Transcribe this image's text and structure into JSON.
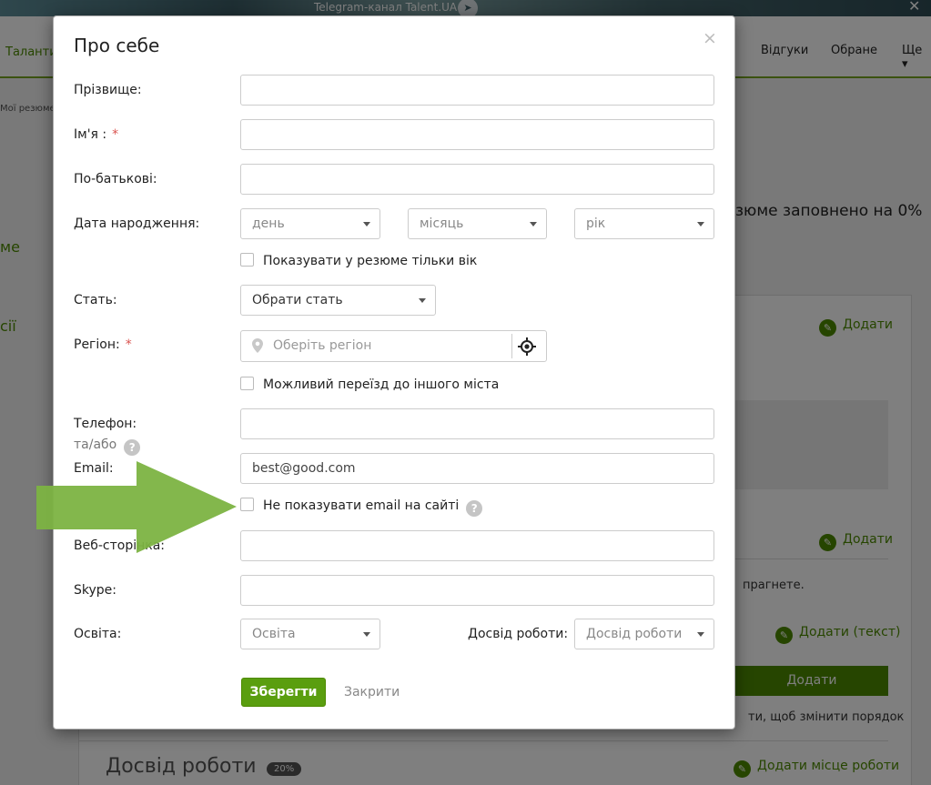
{
  "background": {
    "telegram_text": "Telegram-канал Talent.UA",
    "nav_left": "Таланти",
    "nav_items": [
      "Відгуки",
      "Обране",
      "Ще ▾"
    ],
    "breadcrumb": "Мої резюме",
    "side_items": [
      "ме",
      "сії"
    ],
    "filled_text": "зюме заповнено на 0%",
    "add_label": "Додати",
    "aspirations_text": "прагнете.",
    "add_text_label": "Додати (текст)",
    "add_button": "Додати",
    "order_text": "ти, щоб змінити порядок",
    "experience_title": "Досвід роботи",
    "experience_badge": "20%",
    "add_place_label": "Додати місце роботи"
  },
  "modal": {
    "title": "Про себе",
    "close": "×",
    "surname_label": "Прізвище:",
    "name_label": "Ім'я :",
    "patronymic_label": "По-батькові:",
    "birth_label": "Дата народження:",
    "day_placeholder": "день",
    "month_placeholder": "місяць",
    "year_placeholder": "рік",
    "age_only_checkbox": "Показувати у резюме тільки вік",
    "gender_label": "Стать:",
    "gender_placeholder": "Обрати стать",
    "region_label": "Регіон:",
    "region_placeholder": "Оберіть регіон",
    "relocation_checkbox": "Можливий переїзд до іншого міста",
    "phone_label": "Телефон:",
    "and_or_label": "та/або",
    "email_label": "Email:",
    "email_value": "best@good.com",
    "hide_email_checkbox": "Не показувати email на сайті",
    "website_label": "Веб-сторінка:",
    "skype_label": "Skype:",
    "education_label": "Освіта:",
    "education_placeholder": "Освіта",
    "experience_label": "Досвід роботи:",
    "experience_placeholder": "Досвід роботи",
    "required_mark": "*",
    "help_mark": "?",
    "save_button": "Зберегти",
    "close_link": "Закрити"
  },
  "colors": {
    "accent": "#5a9e0f",
    "arrow": "#7cb342",
    "required": "#d9534f"
  }
}
